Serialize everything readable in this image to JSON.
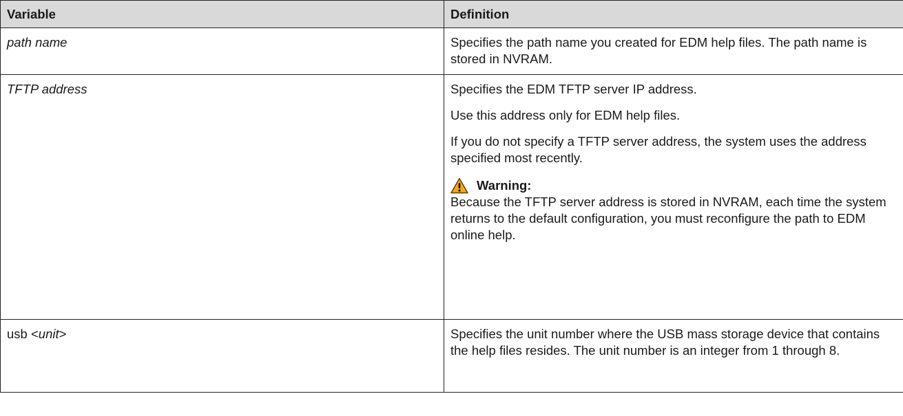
{
  "table": {
    "headers": {
      "variable": "Variable",
      "definition": "Definition"
    },
    "rows": [
      {
        "variable": "path name",
        "definition": [
          "Specifies the path name you created for EDM help files. The path name is stored in NVRAM."
        ]
      },
      {
        "variable": "TFTP address",
        "definition": [
          "Specifies the EDM TFTP server IP address.",
          "Use this address only for EDM help files.",
          "If you do not specify a TFTP server address, the system uses the address specified most recently."
        ],
        "warning": {
          "label": "Warning:",
          "icon": "warning-triangle-icon",
          "icon_color": "#f5a623",
          "text": "Because the TFTP server address is stored in NVRAM, each time the system returns to the default configuration, you must reconfigure the path to EDM online help."
        }
      },
      {
        "variable_plain": "usb <",
        "variable_italic": "unit",
        "variable_close": ">",
        "definition": [
          "Specifies the unit number where the USB mass storage device that contains the help files resides. The unit number is an integer from 1 through 8."
        ]
      }
    ]
  },
  "colors": {
    "header_bg": "#d9d9d9",
    "border": "#222222",
    "warning": "#f5a623"
  }
}
